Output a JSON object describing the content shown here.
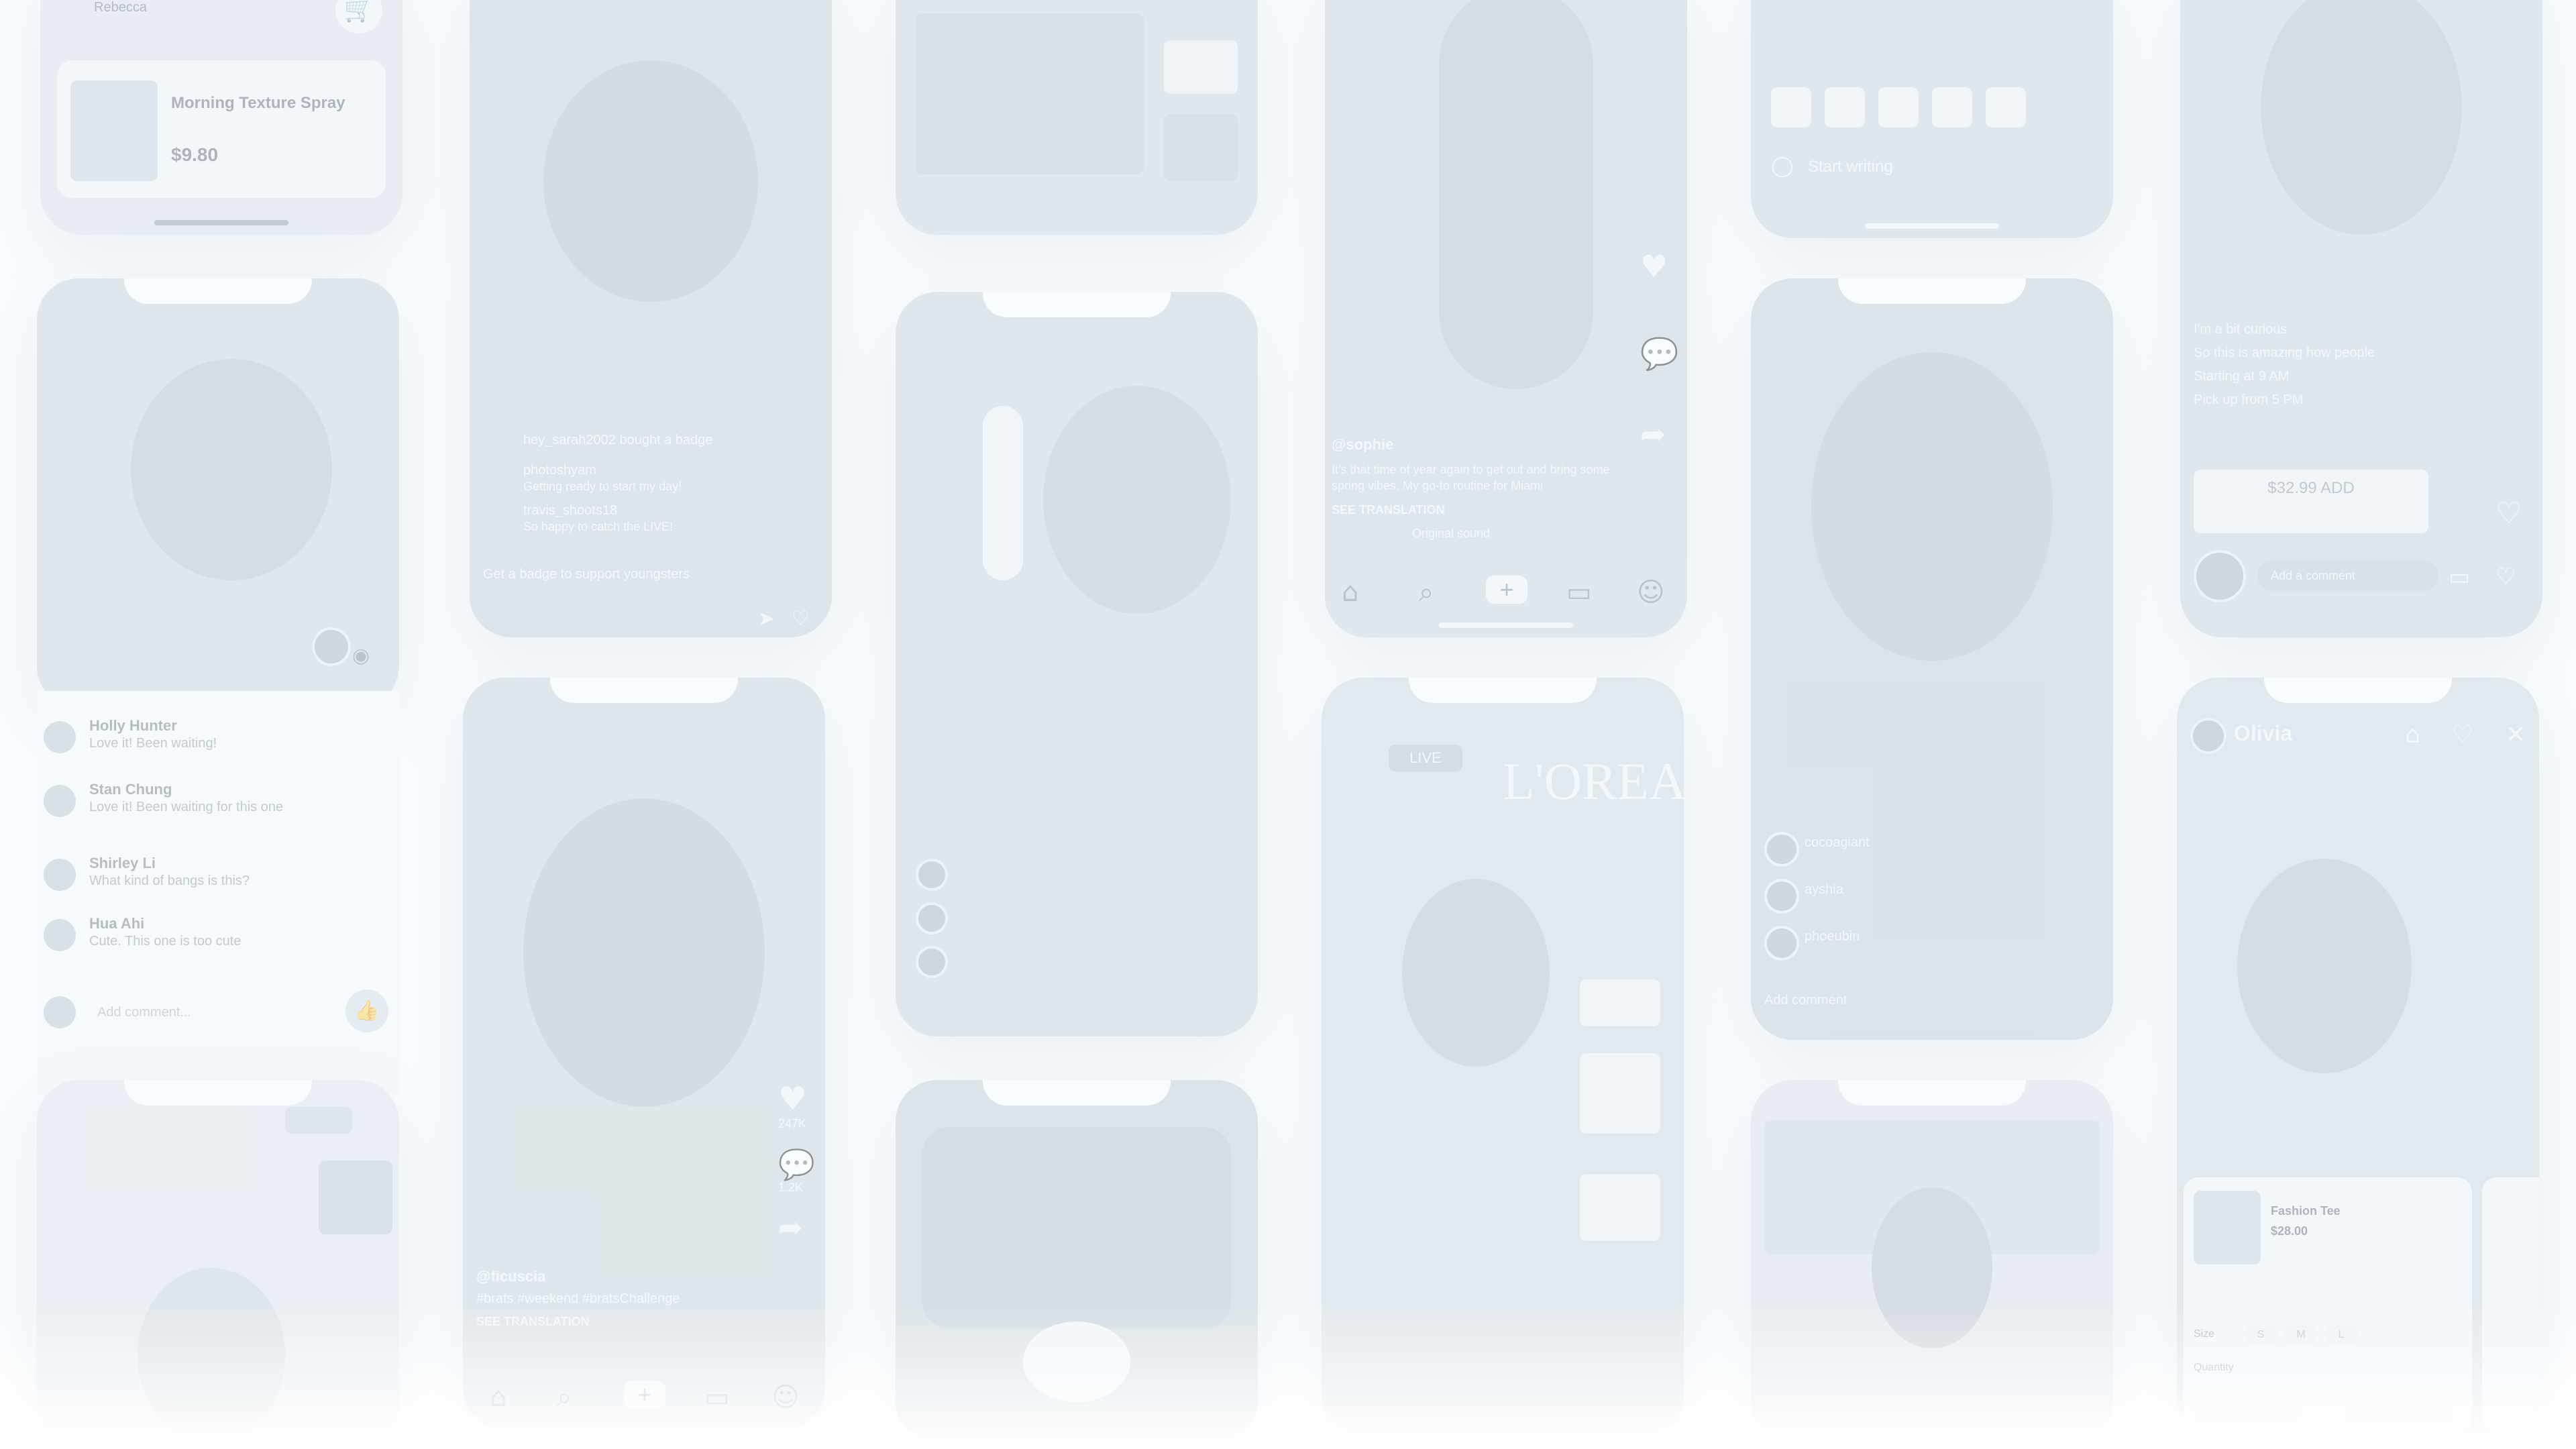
{
  "phone_1": {
    "status": "Rebecca",
    "product_badge": "",
    "product_name": "Morning Texture Spray",
    "product_price": "$9.80"
  },
  "phone_2": {
    "comments": [
      {
        "user": "Holly Hunter",
        "text": "Love it! Been waiting!"
      },
      {
        "user": "Stan Chung",
        "text": "Love it! Been waiting for this one"
      },
      {
        "user": "Shirley Li",
        "text": "What kind of bangs is this?"
      },
      {
        "user": "Hua Ahi",
        "text": "Cute. This one is too cute"
      }
    ],
    "input_placeholder": "Add comment..."
  },
  "phone_4": {
    "live_lines": [
      {
        "user": "hey_sarah2002 bought a badge",
        "text": ""
      },
      {
        "user": "photoshyam",
        "text": "Getting ready to start my day!"
      },
      {
        "user": "travis_shoots18",
        "text": "So happy to catch the LIVE!"
      }
    ],
    "support_text": "Get a badge to support youngsters"
  },
  "phone_5": {
    "caption_user": "@ficuscia",
    "caption": "#brats #weekend #bratsChallenge",
    "see_translation": "SEE TRANSLATION",
    "likes": "247K",
    "comments": "1.2K"
  },
  "phone_8": {
    "username": "@sophie",
    "caption": "It's that time of year again to get out and bring some spring vibes. My go-to routine for Miami",
    "see_translation": "SEE TRANSLATION",
    "sound": "Original sound"
  },
  "phone_9": {
    "brand": "L'OREAL",
    "badge": "LIVE"
  },
  "phone_10": {
    "placeholder": "Start writing"
  },
  "phone_11": {
    "users": [
      "cocoagiant",
      "ayshia",
      "phoeubin"
    ],
    "input_placeholder": "Add comment"
  },
  "phone_13": {
    "lines": [
      "I'm a bit curious",
      "So this is amazing how people",
      "Starting at 9 AM",
      "Pick up from 5 PM"
    ],
    "button": "$32.99 ADD",
    "input_placeholder": "Add a comment"
  },
  "phone_14": {
    "title": "Olivia",
    "product_title": "Fashion Tee",
    "product_price": "$28.00",
    "size_label": "Size",
    "sizes": [
      "S",
      "M",
      "L"
    ],
    "qty_label": "Quantity"
  }
}
